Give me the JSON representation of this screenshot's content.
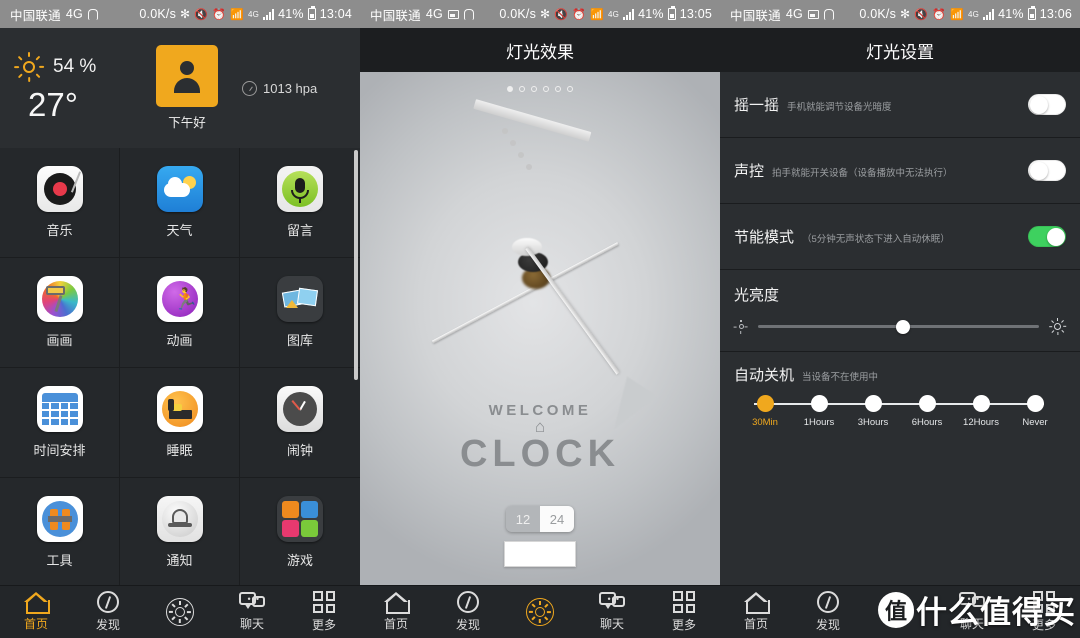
{
  "statusbars": [
    {
      "carrier": "中国联通",
      "net": "4G",
      "speed": "0.0K/s",
      "battery": "41%",
      "time": "13:04",
      "has_image_icon": false
    },
    {
      "carrier": "中国联通",
      "net": "4G",
      "speed": "0.0K/s",
      "battery": "41%",
      "time": "13:05",
      "has_image_icon": true
    },
    {
      "carrier": "中国联通",
      "net": "4G",
      "speed": "0.0K/s",
      "battery": "41%",
      "time": "13:06",
      "has_image_icon": true
    }
  ],
  "home": {
    "weather": {
      "humidity": "54 %",
      "temperature": "27°",
      "greeting": "下午好",
      "pressure": "1013 hpa"
    },
    "apps": [
      {
        "label": "音乐",
        "icon": "vinyl-record-icon"
      },
      {
        "label": "天气",
        "icon": "cloud-sun-icon"
      },
      {
        "label": "留言",
        "icon": "microphone-icon"
      },
      {
        "label": "画画",
        "icon": "paint-roller-icon"
      },
      {
        "label": "动画",
        "icon": "running-person-icon"
      },
      {
        "label": "图库",
        "icon": "photo-gallery-icon"
      },
      {
        "label": "时间安排",
        "icon": "calendar-icon"
      },
      {
        "label": "睡眠",
        "icon": "bed-icon"
      },
      {
        "label": "闹钟",
        "icon": "analog-clock-icon"
      },
      {
        "label": "工具",
        "icon": "tools-icon"
      },
      {
        "label": "通知",
        "icon": "bell-icon"
      },
      {
        "label": "游戏",
        "icon": "games-grid-icon"
      }
    ]
  },
  "nav": {
    "items": [
      {
        "label": "首页",
        "icon": "home-icon"
      },
      {
        "label": "发现",
        "icon": "compass-icon"
      },
      {
        "label": "",
        "icon": "sun-icon"
      },
      {
        "label": "聊天",
        "icon": "chat-bubbles-icon"
      },
      {
        "label": "更多",
        "icon": "grid-icon"
      }
    ],
    "active_index_screen1": 0,
    "active_index_screen2": 2,
    "active_index_screen3": -1
  },
  "light_effect": {
    "title": "灯光效果",
    "page_dots": 6,
    "active_dot": 1,
    "logo_top": "WELCOME",
    "logo_bottom": "CLOCK",
    "format_options": [
      "12",
      "24"
    ],
    "format_selected": "24",
    "text_input_value": "",
    "text_input_placeholder": ""
  },
  "light_settings": {
    "title": "灯光设置",
    "rows": [
      {
        "title": "摇一摇",
        "sub": "手机就能调节设备光暗度",
        "on": false
      },
      {
        "title": "声控",
        "sub": "拍手就能开关设备（设备播放中无法执行）",
        "on": false
      },
      {
        "title": "节能模式",
        "sub": "（5分钟无声状态下进入自动休眠）",
        "on": true
      }
    ],
    "brightness": {
      "title": "光亮度",
      "value": 49
    },
    "auto_off": {
      "title": "自动关机",
      "sub": "当设备不在使用中",
      "options": [
        "30Min",
        "1Hours",
        "3Hours",
        "6Hours",
        "12Hours",
        "Never"
      ],
      "selected": "30Min"
    }
  },
  "watermark": {
    "badge": "值",
    "text": "什么值得买"
  },
  "colors": {
    "accent": "#f0a81e",
    "toggle_on": "#3ed15f",
    "panel_bg": "#2b2e31",
    "nav_bg": "#232629"
  }
}
